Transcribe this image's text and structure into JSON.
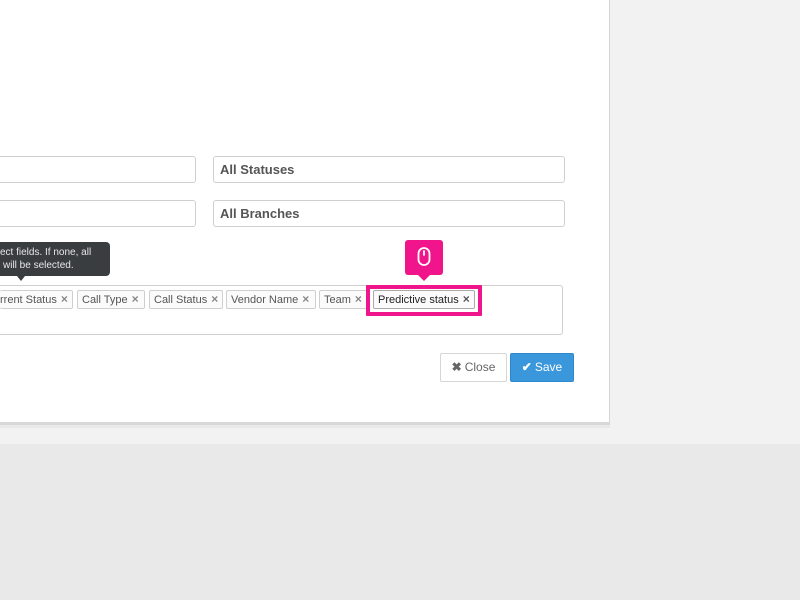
{
  "filters": {
    "status_select": "All Statuses",
    "branch_select": "All Branches"
  },
  "tooltip": {
    "line1": "ect fields. If none, all",
    "line2": "will be selected."
  },
  "tags": [
    {
      "label": "rrent Status",
      "remove": "×"
    },
    {
      "label": "Call Type",
      "remove": "×"
    },
    {
      "label": "Call Status",
      "remove": "×"
    },
    {
      "label": "Vendor Name",
      "remove": "×"
    },
    {
      "label": "Team",
      "remove": "×"
    },
    {
      "label": "Predictive status",
      "remove": "×"
    }
  ],
  "buttons": {
    "close_icon": "✖",
    "close_label": "Close",
    "save_icon": "✔",
    "save_label": "Save"
  },
  "icons": {
    "click_indicator": "mouse-icon",
    "close": "close-icon",
    "save": "check-circle-icon"
  },
  "colors": {
    "highlight": "#f0158a",
    "primary_button": "#3a97dc",
    "tooltip_bg": "#3a3d40"
  }
}
